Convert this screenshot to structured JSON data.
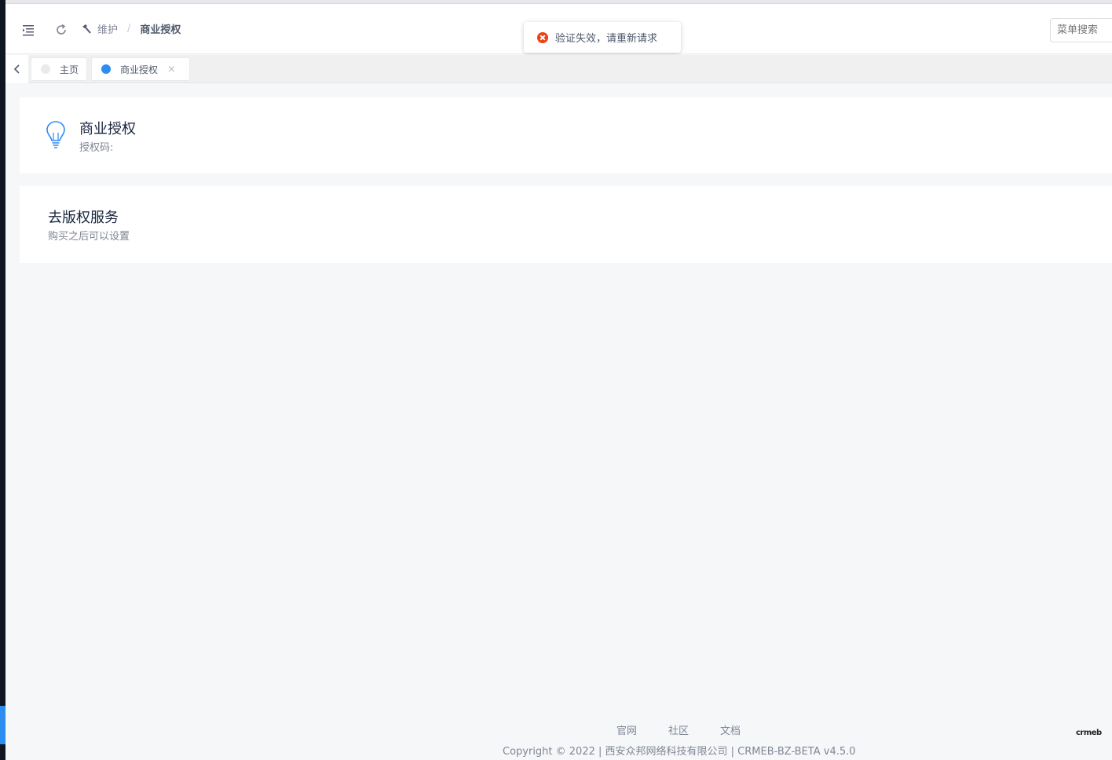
{
  "header": {
    "breadcrumb": {
      "parent": "维护",
      "separator": "/",
      "current": "商业授权"
    },
    "search_placeholder": "菜单搜索"
  },
  "toast": {
    "type": "error",
    "message": "验证失效，请重新请求"
  },
  "tabs": [
    {
      "label": "主页",
      "active": false
    },
    {
      "label": "商业授权",
      "active": true,
      "close": "×"
    }
  ],
  "cards": {
    "auth": {
      "title": "商业授权",
      "subtitle": "授权码:"
    },
    "copyright_service": {
      "title": "去版权服务",
      "subtitle": "购买之后可以设置"
    }
  },
  "footer": {
    "links": [
      "官网",
      "社区",
      "文档"
    ],
    "copyright": "Copyright © 2022 | 西安众邦网络科技有限公司 | CRMEB-BZ-BETA v4.5.0",
    "logo_text": "crmeb"
  },
  "colors": {
    "primary": "#2d8cf0",
    "error": "#ed4014",
    "sidebar": "#0f1521"
  }
}
